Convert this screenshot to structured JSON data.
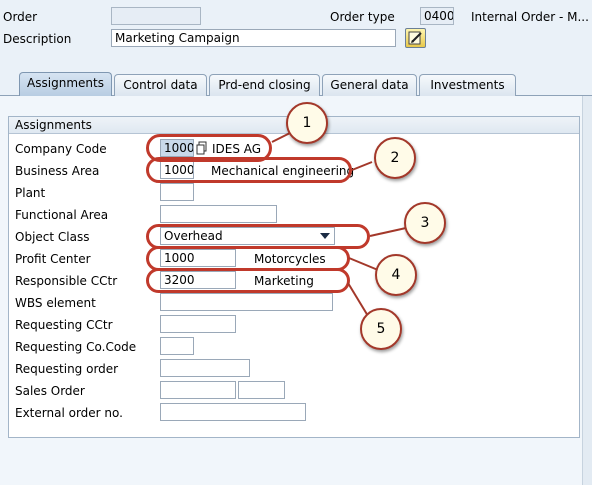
{
  "header": {
    "order_label": "Order",
    "order_value": "",
    "order_type_label": "Order type",
    "order_type_value": "0400",
    "order_type_desc": "Internal Order - M...",
    "description_label": "Description",
    "description_value": "Marketing Campaign"
  },
  "tabs": [
    {
      "label": "Assignments",
      "active": true
    },
    {
      "label": "Control data"
    },
    {
      "label": "Prd-end closing"
    },
    {
      "label": "General data"
    },
    {
      "label": "Investments"
    }
  ],
  "group": {
    "title": "Assignments",
    "fields": {
      "company_code": {
        "label": "Company Code",
        "value": "1000",
        "desc": "IDES AG"
      },
      "business_area": {
        "label": "Business Area",
        "value": "1000",
        "desc": "Mechanical engineering"
      },
      "plant": {
        "label": "Plant",
        "value": ""
      },
      "functional_area": {
        "label": "Functional Area",
        "value": ""
      },
      "object_class": {
        "label": "Object Class",
        "value": "Overhead"
      },
      "profit_center": {
        "label": "Profit Center",
        "value": "1000",
        "desc": "Motorcycles"
      },
      "responsible_cctr": {
        "label": "Responsible CCtr",
        "value": "3200",
        "desc": "Marketing"
      },
      "wbs_element": {
        "label": "WBS element",
        "value": ""
      },
      "requesting_cctr": {
        "label": "Requesting CCtr",
        "value": ""
      },
      "requesting_cocode": {
        "label": "Requesting Co.Code",
        "value": ""
      },
      "requesting_order": {
        "label": "Requesting order",
        "value": ""
      },
      "sales_order": {
        "label": "Sales Order",
        "value": "",
        "item": ""
      },
      "external_order": {
        "label": "External order no.",
        "value": ""
      }
    }
  },
  "callouts": [
    "1",
    "2",
    "3",
    "4",
    "5"
  ],
  "colors": {
    "highlight": "#c0392b",
    "callout_fill": "#fffbe8"
  }
}
